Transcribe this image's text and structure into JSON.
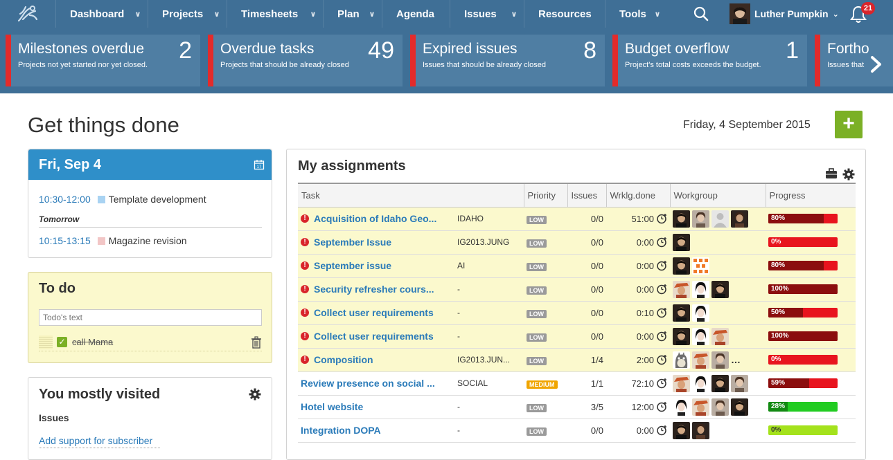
{
  "nav": {
    "items": [
      {
        "label": "Dashboard",
        "caret": true
      },
      {
        "label": "Projects",
        "caret": true
      },
      {
        "label": "Timesheets",
        "caret": true
      },
      {
        "label": "Plan",
        "caret": true
      },
      {
        "label": "Agenda",
        "caret": false
      },
      {
        "label": "Issues",
        "caret": true
      },
      {
        "label": "Resources",
        "caret": false
      },
      {
        "label": "Tools",
        "caret": true
      }
    ],
    "user_name": "Luther Pumpkin",
    "notification_count": "21"
  },
  "alerts": [
    {
      "title": "Milestones overdue",
      "subtitle": "Projects not yet started nor yet closed.",
      "count": "2"
    },
    {
      "title": "Overdue tasks",
      "subtitle": "Projects that should be already closed",
      "count": "49"
    },
    {
      "title": "Expired issues",
      "subtitle": "Issues that should be already closed",
      "count": "8"
    },
    {
      "title": "Budget overflow",
      "subtitle": "Project's total costs exceeds the budget.",
      "count": "1"
    },
    {
      "title": "Fortho",
      "subtitle": "Issues that",
      "count": ""
    }
  ],
  "page": {
    "title": "Get things done",
    "date": "Friday, 4 September 2015",
    "add_label": "+"
  },
  "calendar": {
    "day": "Fri, Sep 4",
    "events": [
      {
        "time": "10:30-12:00",
        "label": "Template development",
        "color": "#a9d3f2"
      },
      {
        "time": "10:15-13:15",
        "label": "Magazine revision",
        "color": "#f2c6c6"
      }
    ],
    "tomorrow_label": "Tomorrow"
  },
  "todo": {
    "title": "To do",
    "placeholder": "Todo's text",
    "items": [
      {
        "label": "call Mama",
        "done": true
      }
    ]
  },
  "visited": {
    "title": "You mostly visited",
    "section": "Issues",
    "link": "Add support for subscriber"
  },
  "assignments": {
    "title": "My assignments",
    "columns": [
      "Task",
      "Priority",
      "Issues",
      "Wrklg.done",
      "Workgroup",
      "Progress"
    ],
    "priority_colors": {
      "LOW": "#9a9a9a",
      "MEDIUM": "#f0a500"
    },
    "rows": [
      {
        "task": "Acquisition of Idaho Geo...",
        "code": "IDAHO",
        "priority": "LOW",
        "issues": "0/0",
        "worklog": "51:00",
        "warn": true,
        "workgroup": [
          "man-dark",
          "woman-light",
          "silhouette",
          "woman-dark"
        ],
        "more": false,
        "progress": "80%",
        "progress_value": 0.8,
        "progress_color": "red"
      },
      {
        "task": "September Issue",
        "code": "IG2013.JUNG",
        "priority": "LOW",
        "issues": "0/0",
        "worklog": "0:00",
        "warn": true,
        "workgroup": [
          "man-dark"
        ],
        "more": false,
        "progress": "0%",
        "progress_value": 0.0,
        "progress_color": "red"
      },
      {
        "task": "September issue",
        "code": "AI",
        "priority": "LOW",
        "issues": "0/0",
        "worklog": "0:00",
        "warn": true,
        "workgroup": [
          "man-dark",
          "pattern-orange"
        ],
        "more": false,
        "progress": "80%",
        "progress_value": 0.8,
        "progress_color": "red"
      },
      {
        "task": "Security refresher cours...",
        "code": "-",
        "priority": "LOW",
        "issues": "0/0",
        "worklog": "0:00",
        "warn": true,
        "workgroup": [
          "hat-orange",
          "woman-pale",
          "man-dark"
        ],
        "more": false,
        "progress": "100%",
        "progress_value": 1.0,
        "progress_color": "red"
      },
      {
        "task": "Collect user requirements",
        "code": "-",
        "priority": "LOW",
        "issues": "0/0",
        "worklog": "0:10",
        "warn": true,
        "workgroup": [
          "man-dark",
          "woman-pale"
        ],
        "more": false,
        "progress": "50%",
        "progress_value": 0.5,
        "progress_color": "red"
      },
      {
        "task": "Collect user requirements",
        "code": "-",
        "priority": "LOW",
        "issues": "0/0",
        "worklog": "0:00",
        "warn": true,
        "workgroup": [
          "man-dark",
          "woman-pale",
          "hat-orange"
        ],
        "more": false,
        "progress": "100%",
        "progress_value": 1.0,
        "progress_color": "red"
      },
      {
        "task": "Composition",
        "code": "IG2013.JUN...",
        "priority": "LOW",
        "issues": "1/4",
        "worklog": "2:00",
        "warn": true,
        "workgroup": [
          "totoro",
          "hat-orange",
          "woman-light"
        ],
        "more": true,
        "progress": "0%",
        "progress_value": 0.0,
        "progress_color": "red"
      },
      {
        "task": "Review presence on social ...",
        "code": "SOCIAL",
        "priority": "MEDIUM",
        "issues": "1/1",
        "worklog": "72:10",
        "warn": false,
        "workgroup": [
          "hat-orange",
          "woman-pale",
          "man-dark",
          "woman-light"
        ],
        "more": false,
        "progress": "59%",
        "progress_value": 0.59,
        "progress_color": "red"
      },
      {
        "task": "Hotel website",
        "code": "-",
        "priority": "LOW",
        "issues": "3/5",
        "worklog": "12:00",
        "warn": false,
        "workgroup": [
          "woman-pale",
          "hat-orange",
          "woman-light",
          "man-dark"
        ],
        "more": false,
        "progress": "28%",
        "progress_value": 0.28,
        "progress_color": "green"
      },
      {
        "task": "Integration DOPA",
        "code": "-",
        "priority": "LOW",
        "issues": "0/0",
        "worklog": "0:00",
        "warn": false,
        "workgroup": [
          "man-dark",
          "woman-dark"
        ],
        "more": false,
        "progress": "0%",
        "progress_value": 0.0,
        "progress_color": "lime"
      }
    ]
  }
}
